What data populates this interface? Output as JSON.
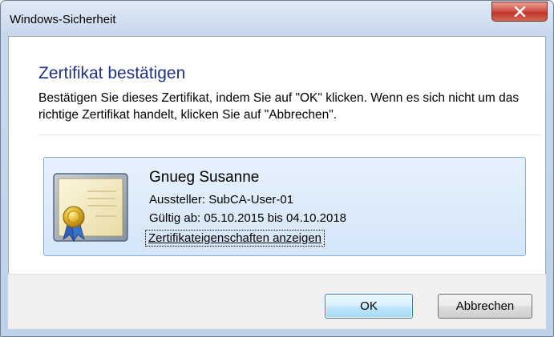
{
  "window": {
    "title": "Windows-Sicherheit"
  },
  "dialog": {
    "heading": "Zertifikat bestätigen",
    "description": "Bestätigen Sie dieses Zertifikat, indem Sie auf \"OK\" klicken. Wenn es sich nicht um das richtige Zertifikat handelt, klicken Sie auf \"Abbrechen\"."
  },
  "certificate": {
    "icon": "certificate-icon",
    "name": "Gnueg Susanne",
    "issuer": "Aussteller: SubCA-User-01",
    "validity": "Gültig ab: 05.10.2015 bis 04.10.2018",
    "properties_link": "Zertifikateigenschaften anzeigen"
  },
  "buttons": {
    "ok": "OK",
    "cancel": "Abbrechen"
  },
  "colors": {
    "heading": "#1e3287",
    "close_button": "#c2322a",
    "cert_box": "#d4e6f9"
  }
}
